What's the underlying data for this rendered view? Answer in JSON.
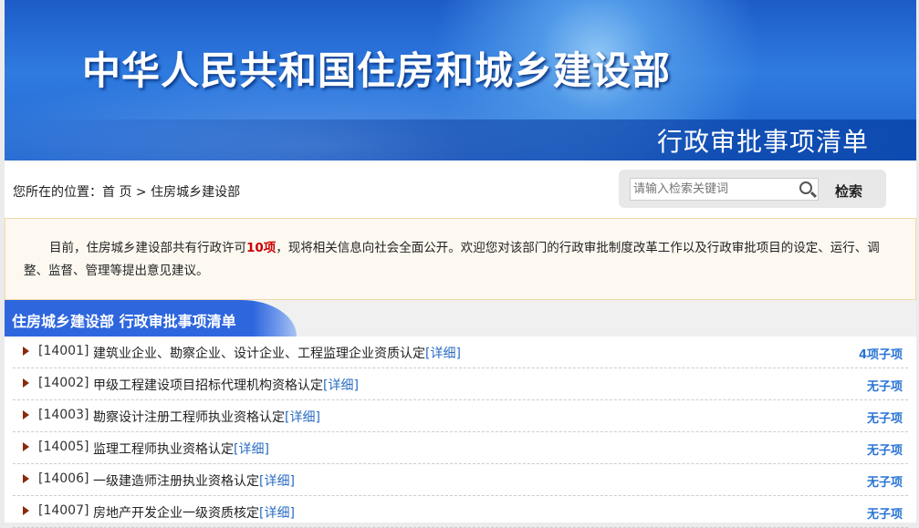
{
  "banner": {
    "title": "中华人民共和国住房和城乡建设部",
    "subtitle": "行政审批事项清单"
  },
  "breadcrumb": {
    "prefix": "您所在的位置：",
    "home": "首 页",
    "sep": ">",
    "current": "住房城乡建设部"
  },
  "search": {
    "placeholder": "请输入检索关键词",
    "button": "检索"
  },
  "notice": {
    "before": "目前，住房城乡建设部共有行政许可",
    "count": "10项",
    "after": "，现将相关信息向社会全面公开。欢迎您对该部门的行政审批制度改革工作以及行政审批项目的设定、运行、调整、监督、管理等提出意见建议。"
  },
  "section": {
    "title": "住房城乡建设部 行政审批事项清单"
  },
  "items": [
    {
      "code": "[14001]",
      "name": "建筑业企业、勘察企业、设计企业、工程监理企业资质认定",
      "detail": "[详细]",
      "sub": "4项子项"
    },
    {
      "code": "[14002]",
      "name": "甲级工程建设项目招标代理机构资格认定",
      "detail": "[详细]",
      "sub": "无子项"
    },
    {
      "code": "[14003]",
      "name": "勘察设计注册工程师执业资格认定",
      "detail": "[详细]",
      "sub": "无子项"
    },
    {
      "code": "[14005]",
      "name": "监理工程师执业资格认定",
      "detail": "[详细]",
      "sub": "无子项"
    },
    {
      "code": "[14006]",
      "name": "一级建造师注册执业资格认定",
      "detail": "[详细]",
      "sub": "无子项"
    },
    {
      "code": "[14007]",
      "name": "房地产开发企业一级资质核定",
      "detail": "[详细]",
      "sub": "无子项"
    }
  ]
}
